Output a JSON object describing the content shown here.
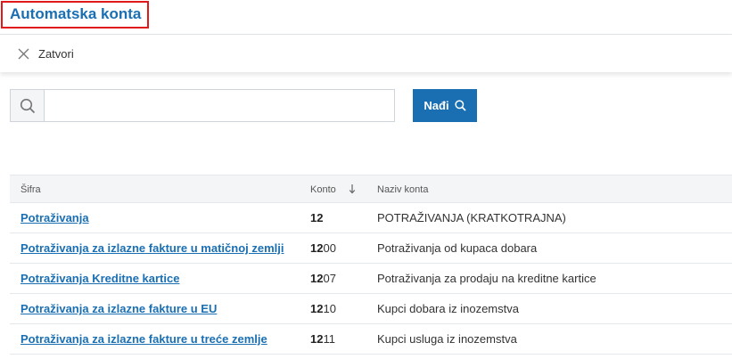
{
  "header": {
    "title": "Automatska konta"
  },
  "toolbar": {
    "close_label": "Zatvori"
  },
  "search": {
    "value": "",
    "button_label": "Nađi"
  },
  "table": {
    "columns": {
      "sifra": "Šifra",
      "konto": "Konto",
      "naziv": "Naziv konta"
    },
    "rows": [
      {
        "sifra": "Potraživanja",
        "konto_bold": "12",
        "konto_rest": "",
        "naziv": "POTRAŽIVANJA (KRATKOTRAJNA)"
      },
      {
        "sifra": "Potraživanja za izlazne fakture u matičnoj zemlji",
        "konto_bold": "12",
        "konto_rest": "00",
        "naziv": "Potraživanja od kupaca dobara"
      },
      {
        "sifra": "Potraživanja Kreditne kartice",
        "konto_bold": "12",
        "konto_rest": "07",
        "naziv": "Potraživanja za prodaju na kreditne kartice"
      },
      {
        "sifra": "Potraživanja za izlazne fakture u EU",
        "konto_bold": "12",
        "konto_rest": "10",
        "naziv": "Kupci dobara iz inozemstva"
      },
      {
        "sifra": "Potraživanja za izlazne fakture u treće zemlje",
        "konto_bold": "12",
        "konto_rest": "11",
        "naziv": "Kupci usluga iz inozemstva"
      }
    ]
  },
  "colors": {
    "accent": "#1a6fb3",
    "highlight_border": "#e01a1a"
  }
}
